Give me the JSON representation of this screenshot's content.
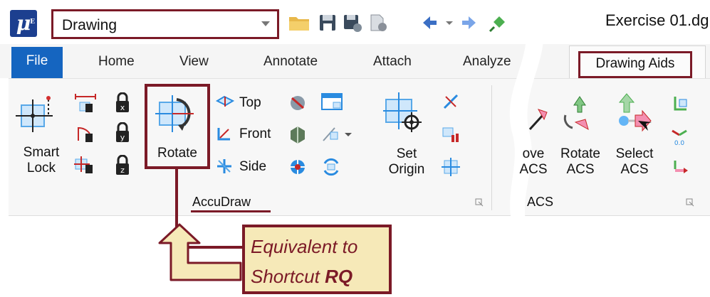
{
  "titlebar": {
    "logo_text": "μ",
    "logo_sub": "E",
    "workflow_select": "Drawing",
    "document_title": "Exercise 01.dg"
  },
  "quick_access_icons": [
    "open-folder-icon",
    "save-icon",
    "save-settings-icon",
    "properties-icon",
    "undo-icon",
    "undo-dropdown-icon",
    "redo-icon",
    "pin-icon"
  ],
  "tabs": {
    "file": "File",
    "home": "Home",
    "view": "View",
    "annotate": "Annotate",
    "attach": "Attach",
    "analyze": "Analyze",
    "drawing_aids": "Drawing Aids"
  },
  "accudraw": {
    "smart_lock_line1": "Smart",
    "smart_lock_line2": "Lock",
    "rotate": "Rotate",
    "top": "Top",
    "front": "Front",
    "side": "Side",
    "set_origin_line1": "Set",
    "set_origin_line2": "Origin",
    "group_label": "AccuDraw"
  },
  "acs": {
    "move_line1": "ove",
    "move_line2": "ACS",
    "rotate_line1": "Rotate",
    "rotate_line2": "ACS",
    "select_line1": "Select",
    "select_line2": "ACS",
    "group_label": "ACS"
  },
  "callout": {
    "line1": "Equivalent to",
    "line2_prefix": "Shortcut ",
    "line2_bold": "RQ"
  },
  "colors": {
    "accent": "#7b1a27",
    "file_tab": "#1565c0",
    "callout_fill": "#f6e9b8"
  }
}
